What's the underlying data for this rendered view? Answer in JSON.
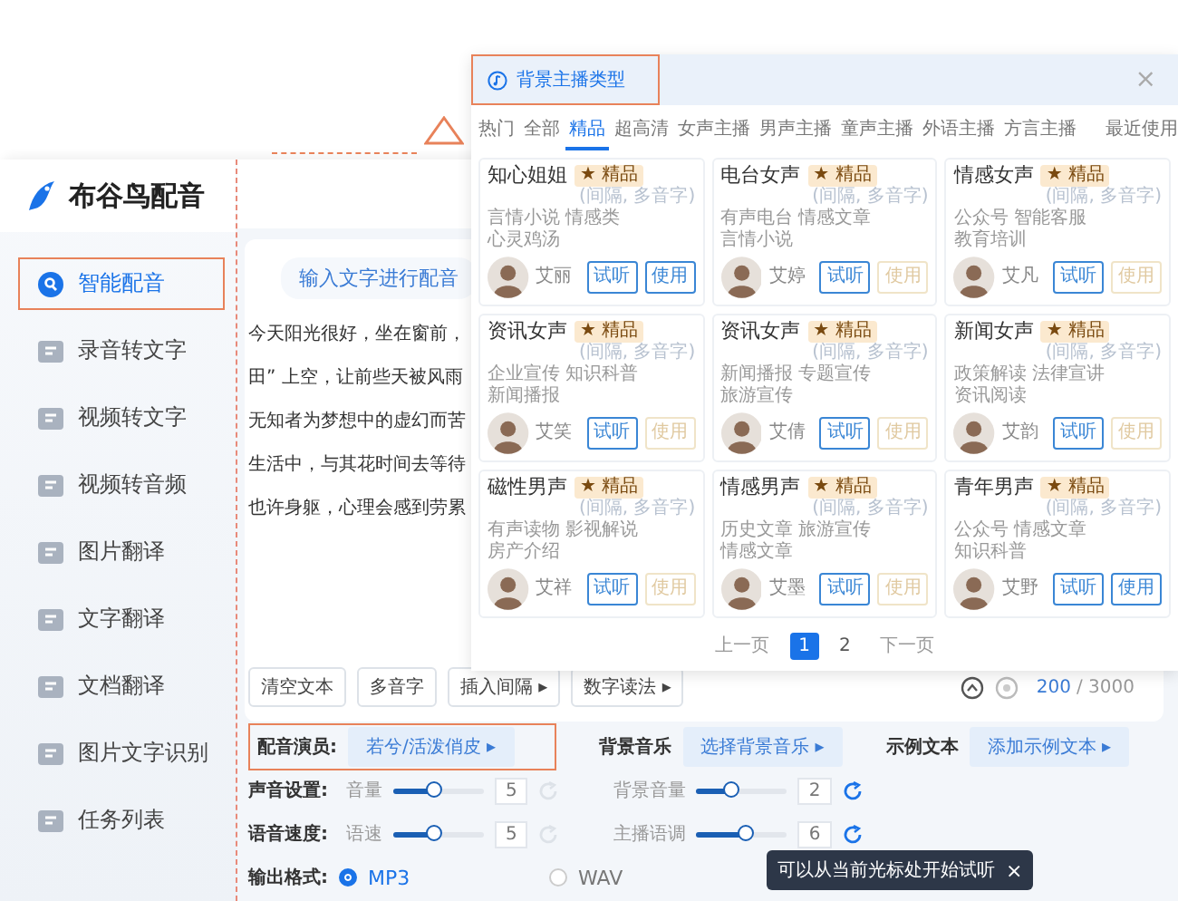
{
  "logo": {
    "name": "布谷鸟配音"
  },
  "sidebar": {
    "items": [
      {
        "label": "智能配音",
        "selected": true
      },
      {
        "label": "录音转文字",
        "selected": false
      },
      {
        "label": "视频转文字",
        "selected": false
      },
      {
        "label": "视频转音频",
        "selected": false
      },
      {
        "label": "图片翻译",
        "selected": false
      },
      {
        "label": "文字翻译",
        "selected": false
      },
      {
        "label": "文档翻译",
        "selected": false
      },
      {
        "label": "图片文字识别",
        "selected": false
      },
      {
        "label": "任务列表",
        "selected": false
      }
    ]
  },
  "editor": {
    "title": "输入文字进行配音",
    "lines": [
      "今天阳光很好，坐在窗前，",
      "田” 上空，让前些天被风雨",
      "无知者为梦想中的虚幻而苦",
      "生活中，与其花时间去等待",
      "也许身躯，心理会感到劳累"
    ],
    "tools": [
      "清空文本",
      "多音字",
      "插入间隔 ▸",
      "数字读法 ▸"
    ],
    "count": "200",
    "limit": "/ 3000"
  },
  "settings": {
    "pickers": [
      {
        "label": "配音演员:",
        "value": "若兮/活泼俏皮 ▸"
      },
      {
        "label": "背景音乐",
        "value": "选择背景音乐 ▸"
      },
      {
        "label": "示例文本",
        "value": "添加示例文本 ▸"
      }
    ],
    "rows": [
      {
        "label": "声音设置:",
        "controls": [
          {
            "name": "音量",
            "level": 0.45,
            "value": "5",
            "reset_enabled": false
          },
          {
            "name": "背景音量",
            "level": 0.4,
            "value": "2",
            "reset_enabled": true
          }
        ]
      },
      {
        "label": "语音速度:",
        "controls": [
          {
            "name": "语速",
            "level": 0.45,
            "value": "5",
            "reset_enabled": false
          },
          {
            "name": "主播语调",
            "level": 0.55,
            "value": "6",
            "reset_enabled": true
          }
        ]
      }
    ],
    "output": {
      "label": "输出格式:",
      "options": [
        {
          "label": "MP3",
          "selected": true
        },
        {
          "label": "WAV",
          "selected": false
        }
      ]
    }
  },
  "tooltip": {
    "text": "可以从当前光标处开始试听",
    "close": "×"
  },
  "dialog": {
    "title": "背景主播类型",
    "close": "×",
    "tabs": [
      {
        "label": "热门",
        "selected": false
      },
      {
        "label": "全部",
        "selected": false
      },
      {
        "label": "精品",
        "selected": true
      },
      {
        "label": "超高清",
        "selected": false
      },
      {
        "label": "女声主播",
        "selected": false
      },
      {
        "label": "男声主播",
        "selected": false
      },
      {
        "label": "童声主播",
        "selected": false
      },
      {
        "label": "外语主播",
        "selected": false
      },
      {
        "label": "方言主播",
        "selected": false
      }
    ],
    "recent_tab": {
      "label": "最近使用",
      "selected": false
    },
    "cards": [
      {
        "name": "知心姐姐",
        "badge": "★ 精品",
        "hint": "(间隔, 多音字)",
        "tags": [
          "言情小说",
          "情感类",
          "心灵鸡汤"
        ],
        "voice": "艾丽",
        "listen": "试听",
        "use": "使用",
        "use_enabled": true
      },
      {
        "name": "电台女声",
        "badge": "★ 精品",
        "hint": "(间隔, 多音字)",
        "tags": [
          "有声电台",
          "情感文章",
          "言情小说"
        ],
        "voice": "艾婷",
        "listen": "试听",
        "use": "使用",
        "use_enabled": false
      },
      {
        "name": "情感女声",
        "badge": "★ 精品",
        "hint": "(间隔, 多音字)",
        "tags": [
          "公众号",
          "智能客服",
          "教育培训"
        ],
        "voice": "艾凡",
        "listen": "试听",
        "use": "使用",
        "use_enabled": false
      },
      {
        "name": "资讯女声",
        "badge": "★ 精品",
        "hint": "(间隔, 多音字)",
        "tags": [
          "企业宣传",
          "知识科普",
          "新闻播报"
        ],
        "voice": "艾笑",
        "listen": "试听",
        "use": "使用",
        "use_enabled": false
      },
      {
        "name": "资讯女声",
        "badge": "★ 精品",
        "hint": "(间隔, 多音字)",
        "tags": [
          "新闻播报",
          "专题宣传",
          "旅游宣传"
        ],
        "voice": "艾倩",
        "listen": "试听",
        "use": "使用",
        "use_enabled": false
      },
      {
        "name": "新闻女声",
        "badge": "★ 精品",
        "hint": "(间隔, 多音字)",
        "tags": [
          "政策解读",
          "法律宣讲",
          "资讯阅读"
        ],
        "voice": "艾韵",
        "listen": "试听",
        "use": "使用",
        "use_enabled": false
      },
      {
        "name": "磁性男声",
        "badge": "★ 精品",
        "hint": "(间隔, 多音字)",
        "tags": [
          "有声读物",
          "影视解说",
          "房产介绍"
        ],
        "voice": "艾祥",
        "listen": "试听",
        "use": "使用",
        "use_enabled": false
      },
      {
        "name": "情感男声",
        "badge": "★ 精品",
        "hint": "(间隔, 多音字)",
        "tags": [
          "历史文章",
          "旅游宣传",
          "情感文章"
        ],
        "voice": "艾墨",
        "listen": "试听",
        "use": "使用",
        "use_enabled": false
      },
      {
        "name": "青年男声",
        "badge": "★ 精品",
        "hint": "(间隔, 多音字)",
        "tags": [
          "公众号",
          "情感文章",
          "知识科普"
        ],
        "voice": "艾野",
        "listen": "试听",
        "use": "使用",
        "use_enabled": true
      }
    ],
    "pager": {
      "prev": "上一页",
      "pages": [
        {
          "label": "1",
          "selected": true
        },
        {
          "label": "2",
          "selected": false
        }
      ],
      "next": "下一页"
    }
  }
}
